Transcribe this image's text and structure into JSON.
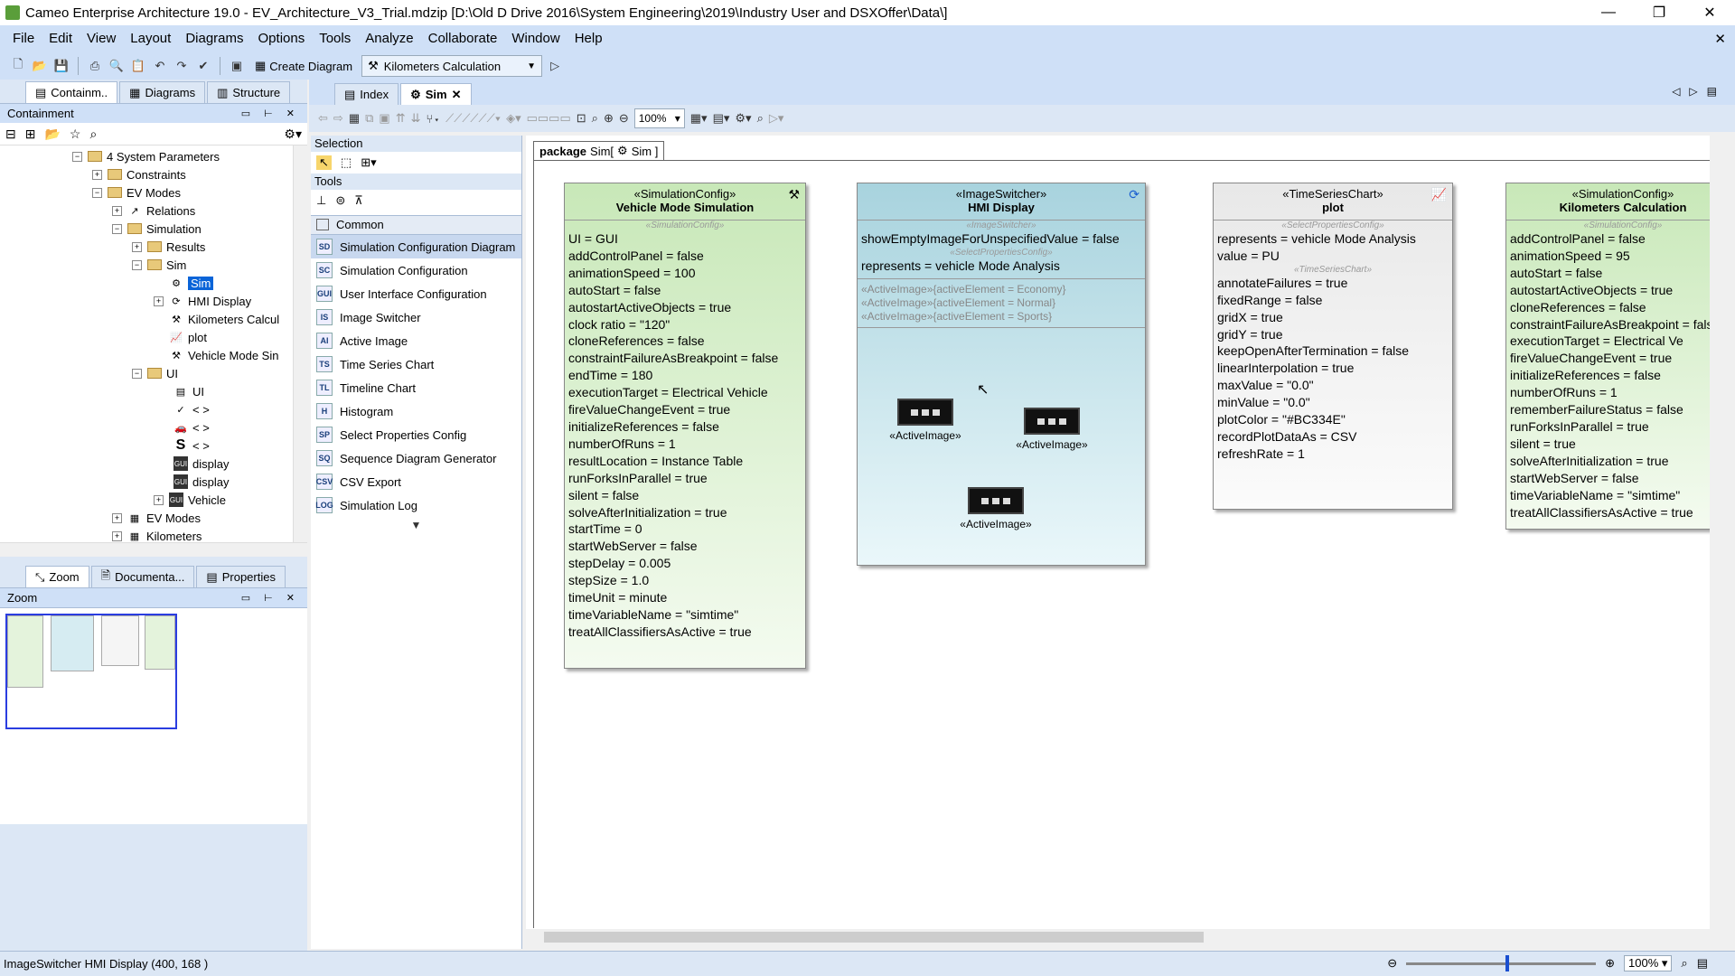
{
  "window": {
    "title": "Cameo Enterprise Architecture 19.0 - EV_Architecture_V3_Trial.mdzip [D:\\Old D Drive 2016\\System Engineering\\2019\\Industry User and DSXOffer\\Data\\]",
    "minimize": "—",
    "maximize": "❐",
    "close": "✕"
  },
  "menu": [
    "File",
    "Edit",
    "View",
    "Layout",
    "Diagrams",
    "Options",
    "Tools",
    "Analyze",
    "Collaborate",
    "Window",
    "Help"
  ],
  "menu_close": "✕",
  "toolbar": {
    "create_diagram": "Create Diagram",
    "run_config": "Kilometers Calculation"
  },
  "left_tabs": [
    "Containm..",
    "Diagrams",
    "Structure"
  ],
  "containment": {
    "title": "Containment",
    "tree": [
      {
        "label": "4 System Parameters",
        "icon": "folder"
      },
      {
        "label": "Constraints",
        "icon": "folder"
      },
      {
        "label": "EV Modes",
        "icon": "folder"
      },
      {
        "label": "Relations",
        "icon": "relation"
      },
      {
        "label": "Simulation",
        "icon": "folder"
      },
      {
        "label": "Results",
        "icon": "folder"
      },
      {
        "label": "Sim",
        "icon": "folder"
      },
      {
        "label": "Sim",
        "icon": "gear"
      },
      {
        "label": "HMI Display",
        "icon": "switch"
      },
      {
        "label": "Kilometers Calcul",
        "icon": "tools"
      },
      {
        "label": "plot",
        "icon": "chart"
      },
      {
        "label": "Vehicle Mode Sin",
        "icon": "tools"
      },
      {
        "label": "UI",
        "icon": "folder"
      },
      {
        "label": "UI",
        "icon": "ui"
      },
      {
        "label": "< >",
        "icon": "check"
      },
      {
        "label": "< >",
        "icon": "car"
      },
      {
        "label": "< >",
        "icon": "s"
      },
      {
        "label": "display",
        "icon": "gui"
      },
      {
        "label": "display",
        "icon": "gui"
      },
      {
        "label": "Vehicle",
        "icon": "gui"
      },
      {
        "label": "EV Modes",
        "icon": "pkg"
      },
      {
        "label": "Kilometers",
        "icon": "pkg"
      }
    ]
  },
  "bottom_tabs": [
    "Zoom",
    "Documenta...",
    "Properties"
  ],
  "zoom_panel_title": "Zoom",
  "diagram_tabs": [
    "Index",
    "Sim"
  ],
  "diagram_toolbar": {
    "zoom": "100%"
  },
  "palette": {
    "selection": "Selection",
    "tools": "Tools",
    "group": "Common",
    "items": [
      {
        "label": "Simulation Configuration Diagram",
        "icon": "SD"
      },
      {
        "label": "Simulation Configuration",
        "icon": "SC"
      },
      {
        "label": "User Interface Configuration",
        "icon": "GUI"
      },
      {
        "label": "Image Switcher",
        "icon": "IS"
      },
      {
        "label": "Active Image",
        "icon": "AI"
      },
      {
        "label": "Time Series Chart",
        "icon": "TS"
      },
      {
        "label": "Timeline Chart",
        "icon": "TL"
      },
      {
        "label": "Histogram",
        "icon": "H"
      },
      {
        "label": "Select Properties Config",
        "icon": "SP"
      },
      {
        "label": "Sequence Diagram Generator",
        "icon": "SQ"
      },
      {
        "label": "CSV Export",
        "icon": "CSV"
      },
      {
        "label": "Simulation Log",
        "icon": "LOG"
      }
    ]
  },
  "package_tab": {
    "keyword": "package",
    "name": "Sim[",
    "diagram": "Sim ]"
  },
  "blocks": {
    "vehicle_mode": {
      "stereotype": "«SimulationConfig»",
      "name": "Vehicle Mode Simulation",
      "compartment": "«SimulationConfig»",
      "props": [
        "UI = GUI",
        "addControlPanel = false",
        "animationSpeed = 100",
        "autoStart = false",
        "autostartActiveObjects = true",
        "clock ratio = \"120\"",
        "cloneReferences = false",
        "constraintFailureAsBreakpoint = false",
        "endTime = 180",
        "executionTarget = Electrical Vehicle",
        "fireValueChangeEvent = true",
        "initializeReferences = false",
        "numberOfRuns = 1",
        "resultLocation = Instance Table",
        "runForksInParallel = true",
        "silent = false",
        "solveAfterInitialization = true",
        "startTime = 0",
        "startWebServer = false",
        "stepDelay = 0.005",
        "stepSize = 1.0",
        "timeUnit = minute",
        "timeVariableName = \"simtime\"",
        "treatAllClassifiersAsActive = true"
      ]
    },
    "hmi": {
      "stereotype": "«ImageSwitcher»",
      "name": "HMI Display",
      "compartment1": "«ImageSwitcher»",
      "prop1": "showEmptyImageForUnspecifiedValue = false",
      "compartment2": "«SelectPropertiesConfig»",
      "prop2": "represents = vehicle Mode Analysis",
      "active_lines": [
        "«ActiveImage»{activeElement = Economy}",
        "«ActiveImage»{activeElement = Normal}",
        "«ActiveImage»{activeElement = Sports}"
      ],
      "active_image_label": "«ActiveImage»"
    },
    "plot": {
      "stereotype": "«TimeSeriesChart»",
      "name": "plot",
      "compartment1": "«SelectPropertiesConfig»",
      "props1": [
        "represents = vehicle Mode Analysis",
        "value = PU"
      ],
      "compartment2": "«TimeSeriesChart»",
      "props2": [
        "annotateFailures = true",
        "fixedRange = false",
        "gridX = true",
        "gridY = true",
        "keepOpenAfterTermination = false",
        "linearInterpolation = true",
        "maxValue = \"0.0\"",
        "minValue = \"0.0\"",
        "plotColor = \"#BC334E\"",
        "recordPlotDataAs = CSV",
        "refreshRate = 1"
      ]
    },
    "km": {
      "stereotype": "«SimulationConfig»",
      "name": "Kilometers Calculation",
      "compartment": "«SimulationConfig»",
      "props": [
        "addControlPanel = false",
        "animationSpeed = 95",
        "autoStart = false",
        "autostartActiveObjects = true",
        "cloneReferences = false",
        "constraintFailureAsBreakpoint = false",
        "executionTarget = Electrical Ve",
        "fireValueChangeEvent = true",
        "initializeReferences = false",
        "numberOfRuns = 1",
        "rememberFailureStatus = false",
        "runForksInParallel = true",
        "silent = true",
        "solveAfterInitialization = true",
        "startWebServer = false",
        "timeVariableName = \"simtime\"",
        "treatAllClassifiersAsActive = true"
      ]
    }
  },
  "status": {
    "text": "ImageSwitcher HMI Display (400, 168 )",
    "zoom": "100%"
  }
}
